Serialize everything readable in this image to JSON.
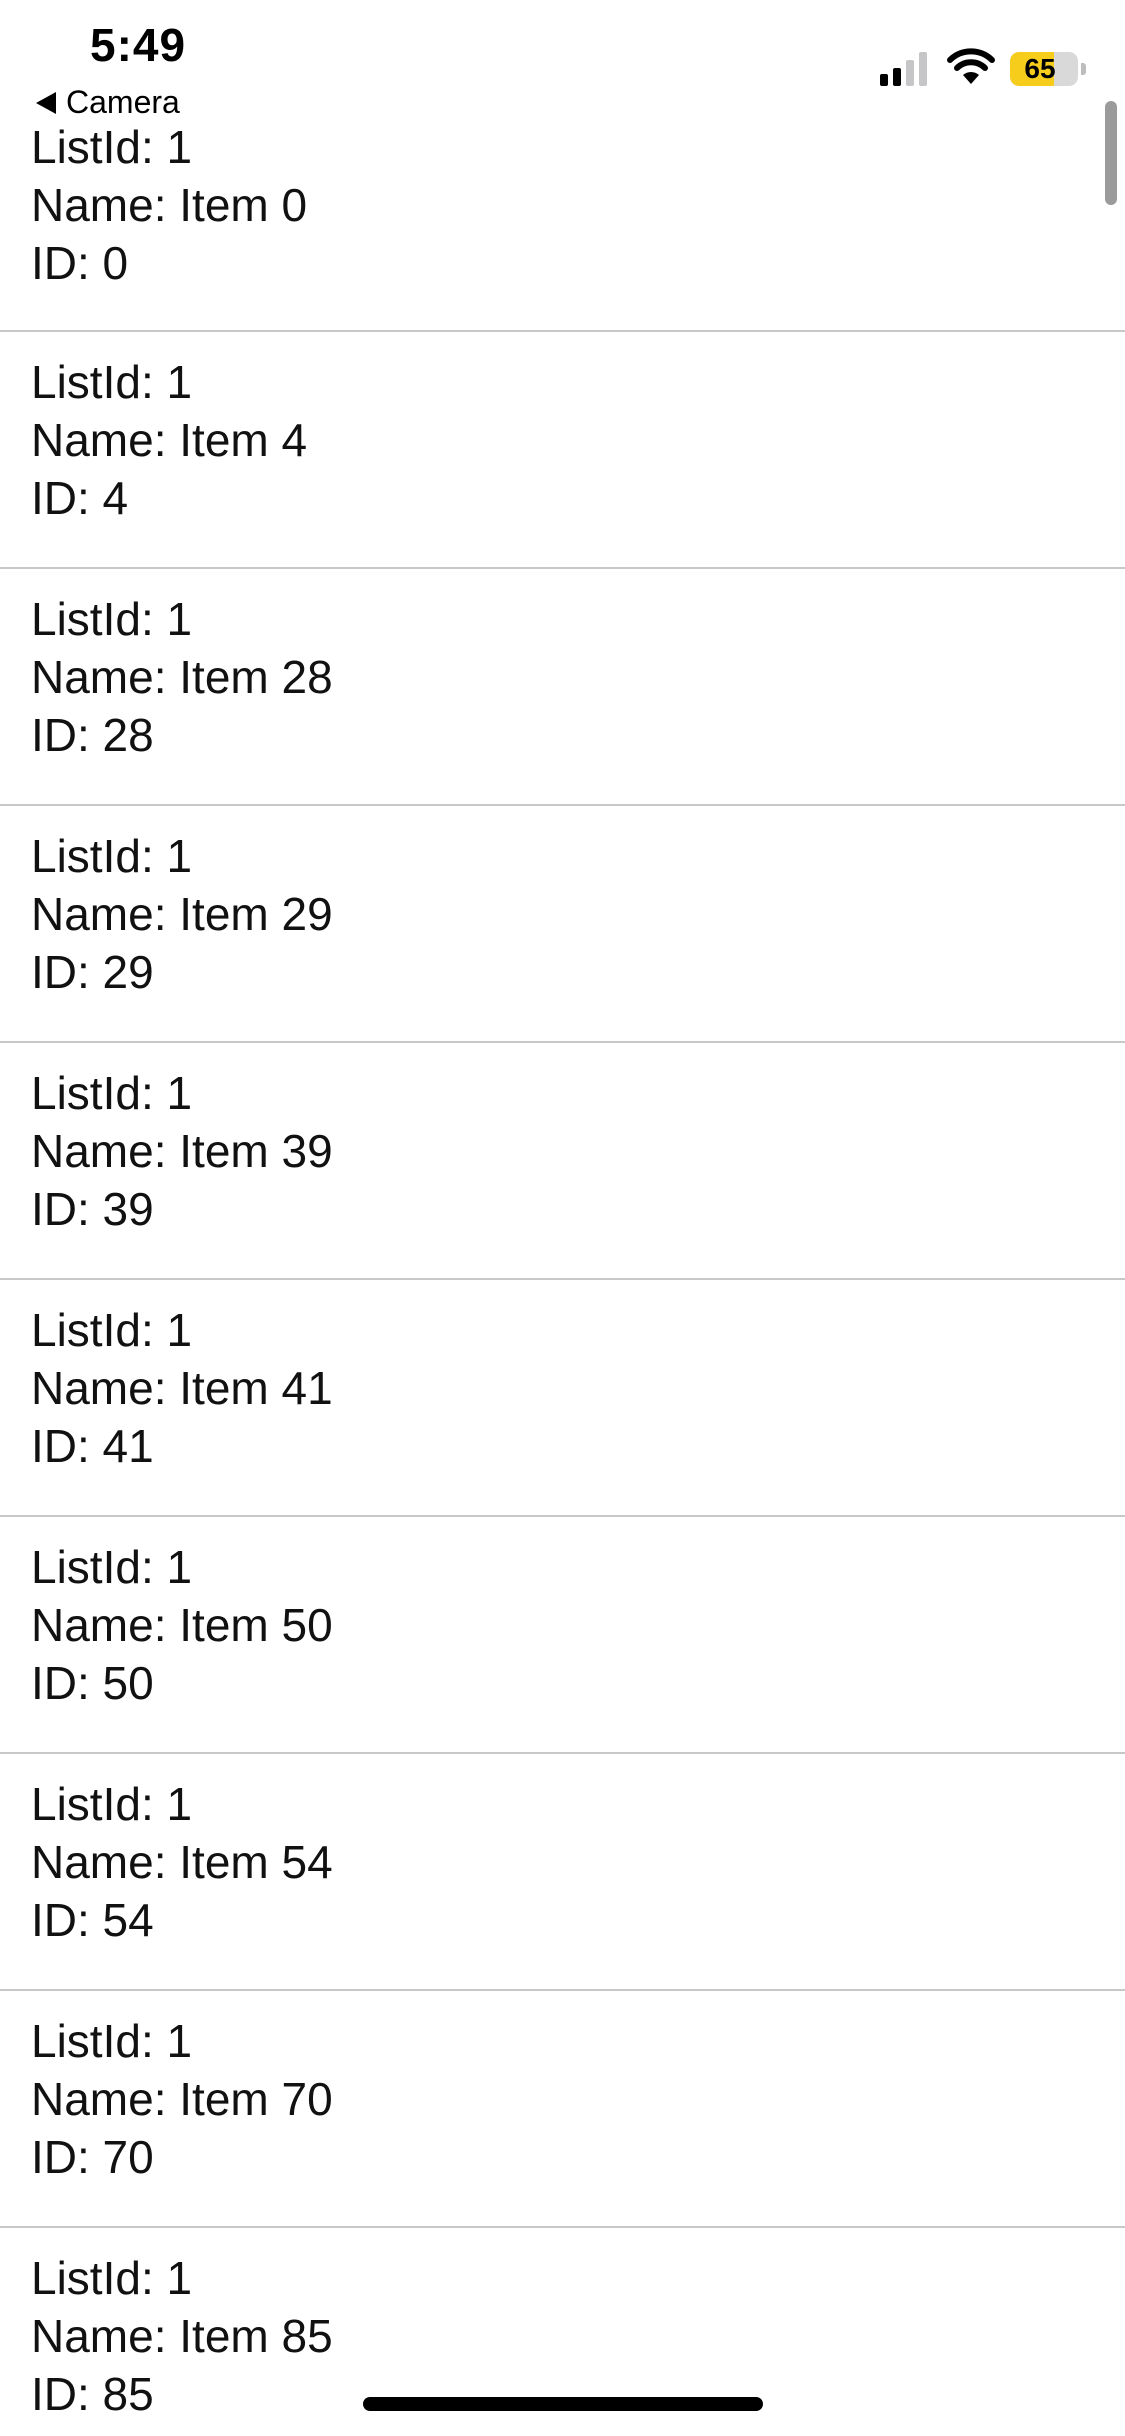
{
  "status_bar": {
    "time": "5:49",
    "back_label": "Camera",
    "battery_level": "65",
    "signal_bars_active": 2,
    "signal_bars_total": 4,
    "battery_color": "#f7cd1c"
  },
  "items": [
    {
      "list_id": "ListId: 1",
      "name": "Name: Item 0",
      "id": "ID: 0"
    },
    {
      "list_id": "ListId: 1",
      "name": "Name: Item 4",
      "id": "ID: 4"
    },
    {
      "list_id": "ListId: 1",
      "name": "Name: Item 28",
      "id": "ID: 28"
    },
    {
      "list_id": "ListId: 1",
      "name": "Name: Item 29",
      "id": "ID: 29"
    },
    {
      "list_id": "ListId: 1",
      "name": "Name: Item 39",
      "id": "ID: 39"
    },
    {
      "list_id": "ListId: 1",
      "name": "Name: Item 41",
      "id": "ID: 41"
    },
    {
      "list_id": "ListId: 1",
      "name": "Name: Item 50",
      "id": "ID: 50"
    },
    {
      "list_id": "ListId: 1",
      "name": "Name: Item 54",
      "id": "ID: 54"
    },
    {
      "list_id": "ListId: 1",
      "name": "Name: Item 70",
      "id": "ID: 70"
    },
    {
      "list_id": "ListId: 1",
      "name": "Name: Item 85",
      "id": "ID: 85"
    }
  ],
  "icons": {
    "back": "back-arrow-icon",
    "signal": "cellular-signal-icon",
    "wifi": "wifi-icon",
    "battery": "battery-icon"
  }
}
